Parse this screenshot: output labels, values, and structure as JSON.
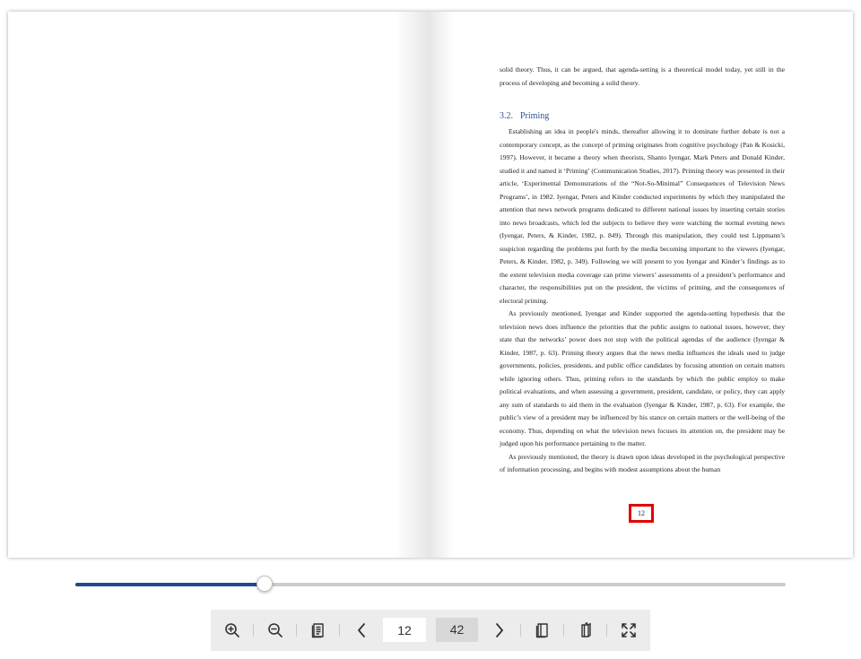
{
  "document": {
    "intro_lines": [
      "solid theory. Thus, it can be argued, that agenda-setting is a theoretical model today, yet still in the process of developing and becoming a solid theory."
    ],
    "section": {
      "number": "3.2.",
      "title": "Priming"
    },
    "paragraphs": [
      "Establishing an idea in people's minds, thereafter allowing it to dominate further debate is not a contemporary concept, as the concept of priming originates from cognitive psychology (Pan & Kosicki, 1997). However, it became a theory when theorists, Shanto Iyengar, Mark Peters and Donald Kinder, studied it and named it ‘Priming’ (Communication Studies, 2017). Priming theory was presented in their article, ‘Experimental Demonstrations of the “Not-So-Minimal” Consequences of Television News Programs’, in 1982. Iyengar, Peters and Kinder conducted experiments by which they manipulated the attention that news network programs dedicated to different national issues by inserting certain stories into news broadcasts, which led the subjects to believe they were watching the normal evening news (Iyengar, Peters, & Kinder, 1982, p. 849). Through this manipulation, they could test Lippmann’s suspicion regarding the problems put forth by the media becoming important to the viewers (Iyengar, Peters, & Kinder, 1982, p. 349). Following we will present to you Iyengar and Kinder’s findings as to the extent television media coverage can prime viewers’ assessments of a president’s performance and character, the responsibilities put on the president, the victims of priming, and the consequences of electoral priming.",
      "As previously mentioned, Iyengar and Kinder supported the agenda-setting hypothesis that the television news does influence the priorities that the public assigns to national issues, however, they state that the networks’ power does not stop with the political agendas of the audience (Iyengar & Kinder, 1987, p. 63). Priming theory argues that the news media influences the ideals used to judge governments, policies, presidents, and public office candidates by focusing attention on certain matters while ignoring others. Thus, priming refers to the standards by which the public employ to make political evaluations, and when assessing a government, president, candidate, or policy, they can apply any sum of standards to aid them in the evaluation (Iyengar & Kinder, 1987, p. 63). For example, the public’s view of a president may be influenced by his stance on certain matters or the well-being of the economy. Thus, depending on what the television news focuses its attention on, the president may be judged upon his performance pertaining to the matter.",
      "As previously mentioned, the theory is drawn upon ideas developed in the psychological perspective of information processing, and begins with modest assumptions about the human"
    ],
    "page_number": "12"
  },
  "slider": {
    "progress": 0.267
  },
  "toolbar": {
    "current_page": "12",
    "total_pages": "42",
    "icons": [
      "zoom-in-icon",
      "zoom-out-icon",
      "table-of-contents-icon",
      "chevron-left-icon",
      "chevron-right-icon",
      "single-page-icon",
      "double-page-icon",
      "fullscreen-icon"
    ]
  },
  "colors": {
    "accent": "#1f4a8c",
    "heading": "#2e5496",
    "highlight": "#e00000",
    "toolbar_bg": "#ececec"
  }
}
